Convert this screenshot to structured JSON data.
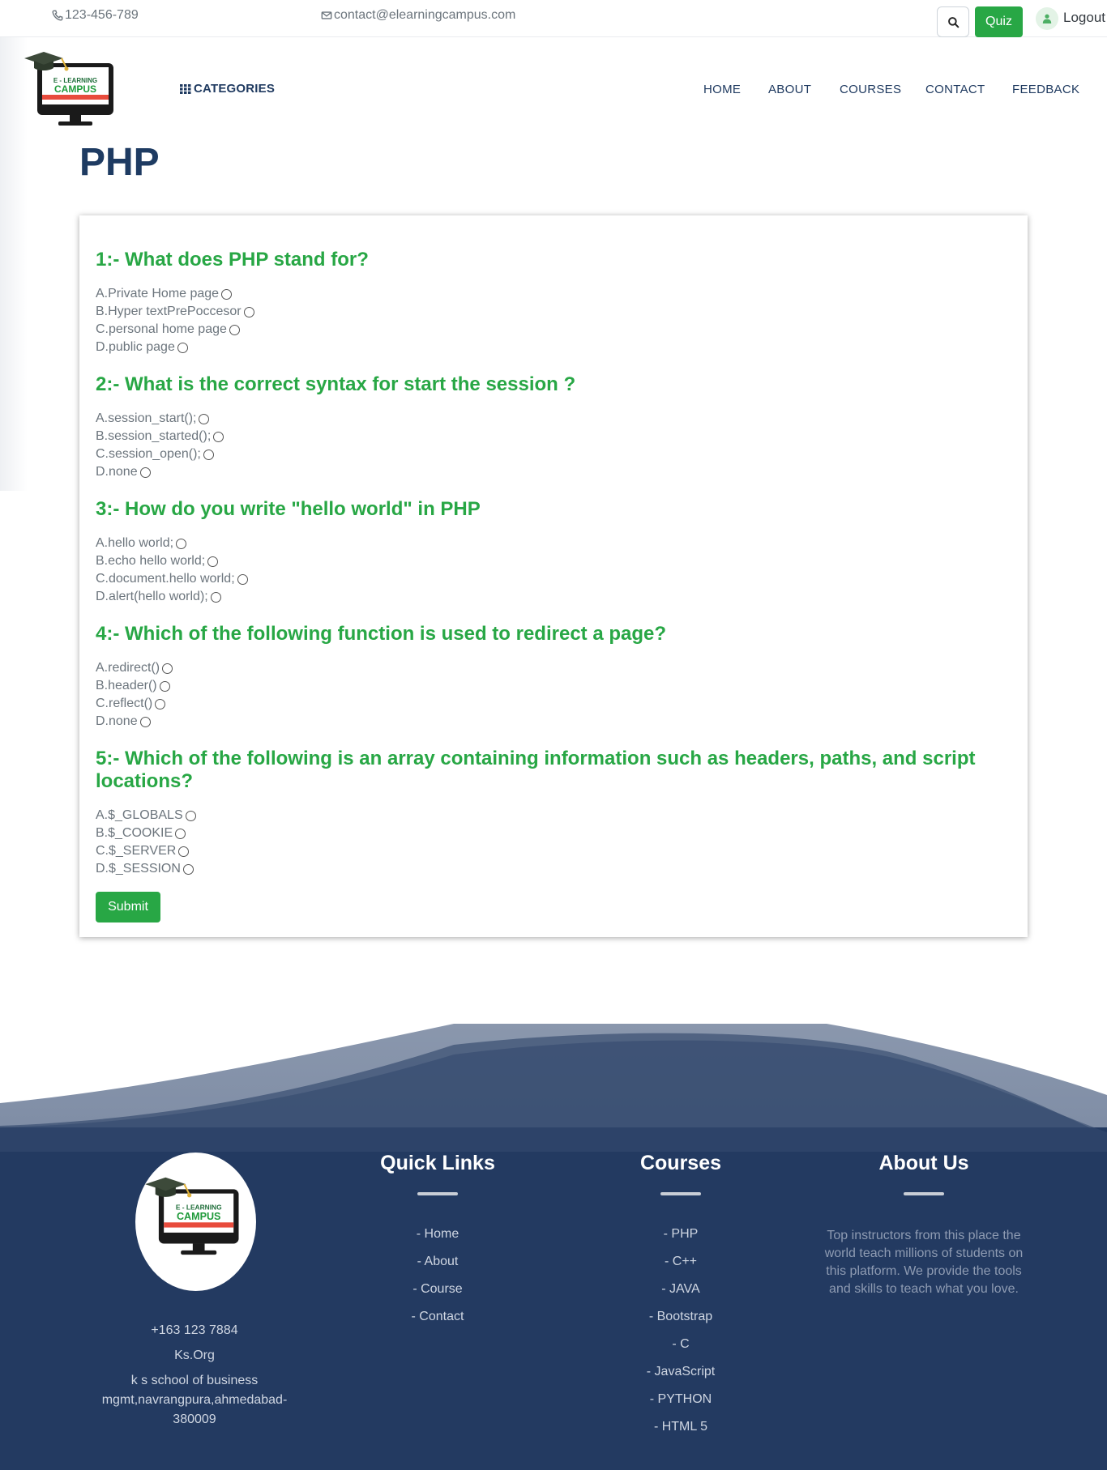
{
  "topbar": {
    "phone": "123-456-789",
    "email": "contact@elearningcampus.com",
    "quiz_label": "Quiz",
    "logout_label": "Logout"
  },
  "logo": {
    "line1": "E - LEARNING",
    "line2": "CAMPUS"
  },
  "navbar": {
    "categories_label": "CATEGORIES",
    "links": [
      "HOME",
      "ABOUT",
      "COURSES",
      "CONTACT",
      "FEEDBACK"
    ]
  },
  "page_title": "PHP",
  "quiz": {
    "questions": [
      {
        "title": "1:- What does PHP stand for?",
        "options": [
          "A.Private Home page",
          "B.Hyper textPrePoccesor",
          "C.personal home page",
          "D.public page"
        ]
      },
      {
        "title": "2:- What is the correct syntax for start the session ?",
        "options": [
          "A.session_start();",
          "B.session_started();",
          "C.session_open();",
          "D.none"
        ]
      },
      {
        "title": "3:- How do you write \"hello world\" in PHP",
        "options": [
          "A.hello world;",
          "B.echo hello world;",
          "C.document.hello world;",
          "D.alert(hello world);"
        ]
      },
      {
        "title": "4:- Which of the following function is used to redirect a page?",
        "options": [
          "A.redirect()",
          "B.header()",
          "C.reflect()",
          "D.none"
        ]
      },
      {
        "title": "5:- Which of the following is an array containing information such as headers, paths, and script locations?",
        "options": [
          "A.$_GLOBALS",
          "B.$_COOKIE",
          "C.$_SERVER",
          "D.$_SESSION"
        ]
      }
    ],
    "submit_label": "Submit"
  },
  "footer": {
    "phone": "+163 123 7884",
    "org": "Ks.Org",
    "address": "k s school of business mgmt,navrangpura,ahmedabad-380009",
    "quick_links": {
      "heading": "Quick Links",
      "items": [
        "-  Home",
        "-  About",
        "-  Course",
        "-  Contact"
      ]
    },
    "courses": {
      "heading": "Courses",
      "items": [
        "-  PHP",
        "-  C++",
        "-  JAVA",
        "-  Bootstrap",
        "-  C",
        "-  JavaScript",
        "-  PYTHON",
        "-  HTML 5"
      ]
    },
    "about": {
      "heading": "About Us",
      "text": "Top instructors from this place the world teach millions of students on this platform. We provide the tools and skills to teach what you love."
    }
  },
  "colors": {
    "accent_green": "#28a745",
    "title_navy": "#1e3b62",
    "footer_navy": "#233a61"
  }
}
